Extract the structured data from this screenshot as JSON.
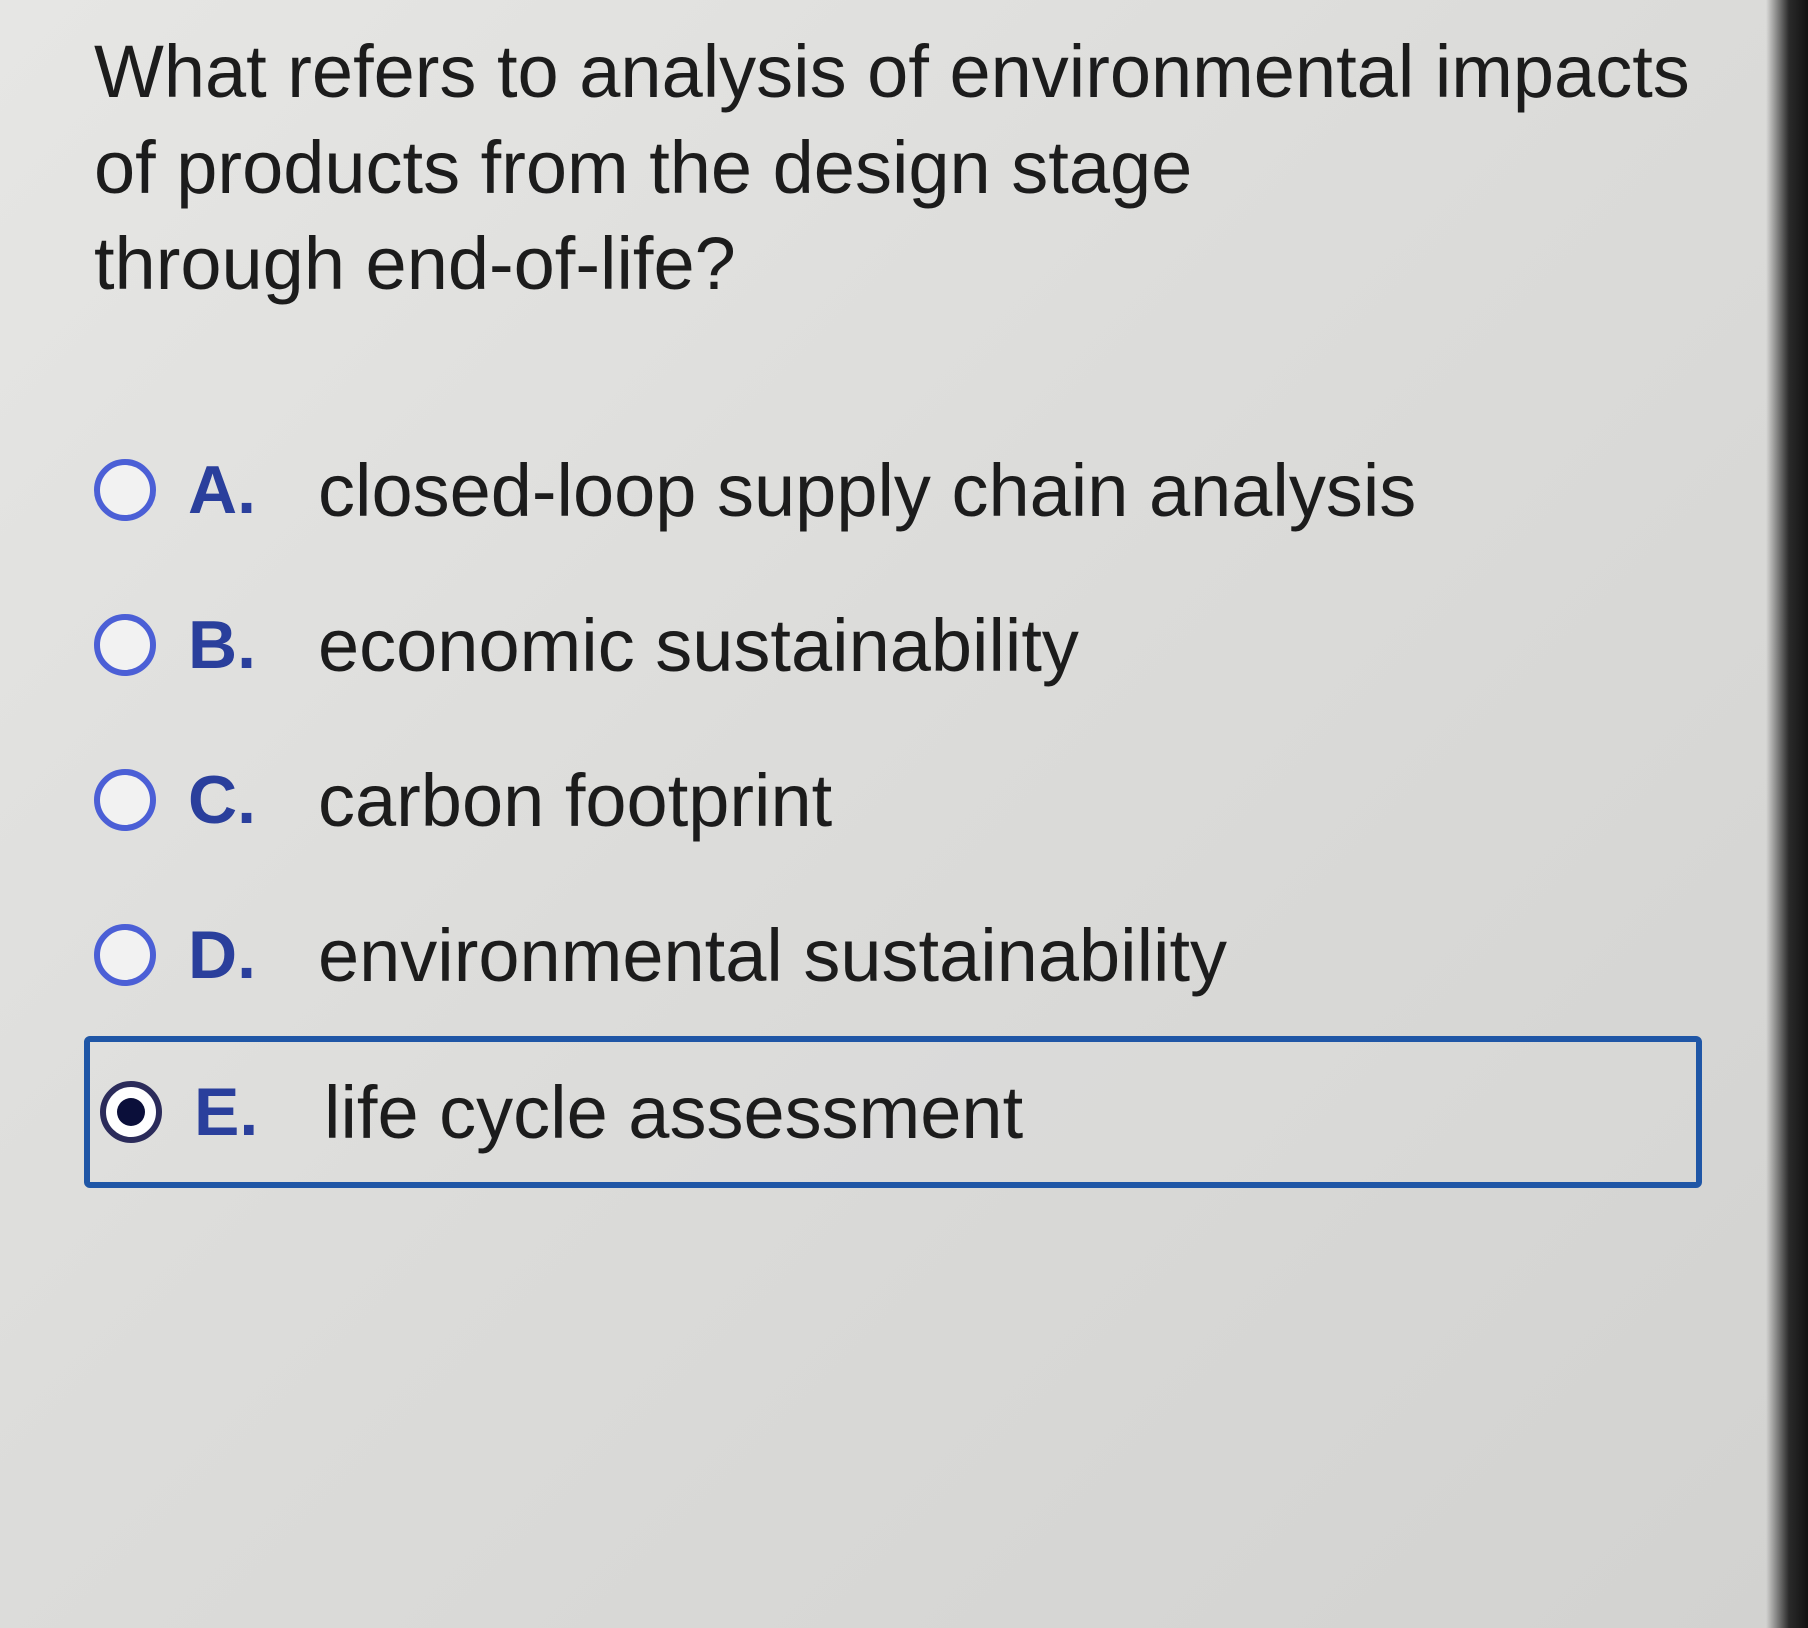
{
  "question": {
    "lines": [
      "What refers to analysis of environmental impacts",
      "of products from the design stage",
      "through end-of-life?"
    ]
  },
  "options": [
    {
      "letter": "A.",
      "text": "closed-loop supply chain analysis",
      "selected": false
    },
    {
      "letter": "B.",
      "text": "economic sustainability",
      "selected": false
    },
    {
      "letter": "C.",
      "text": "carbon footprint",
      "selected": false
    },
    {
      "letter": "D.",
      "text": "environmental sustainability",
      "selected": false
    },
    {
      "letter": "E.",
      "text": "life cycle assessment",
      "selected": true
    }
  ],
  "colors": {
    "radio_border": "#4b5fd6",
    "letter": "#2a3f9c",
    "selected_outline": "#1f56a6",
    "selected_dot": "#0b0f3a"
  }
}
